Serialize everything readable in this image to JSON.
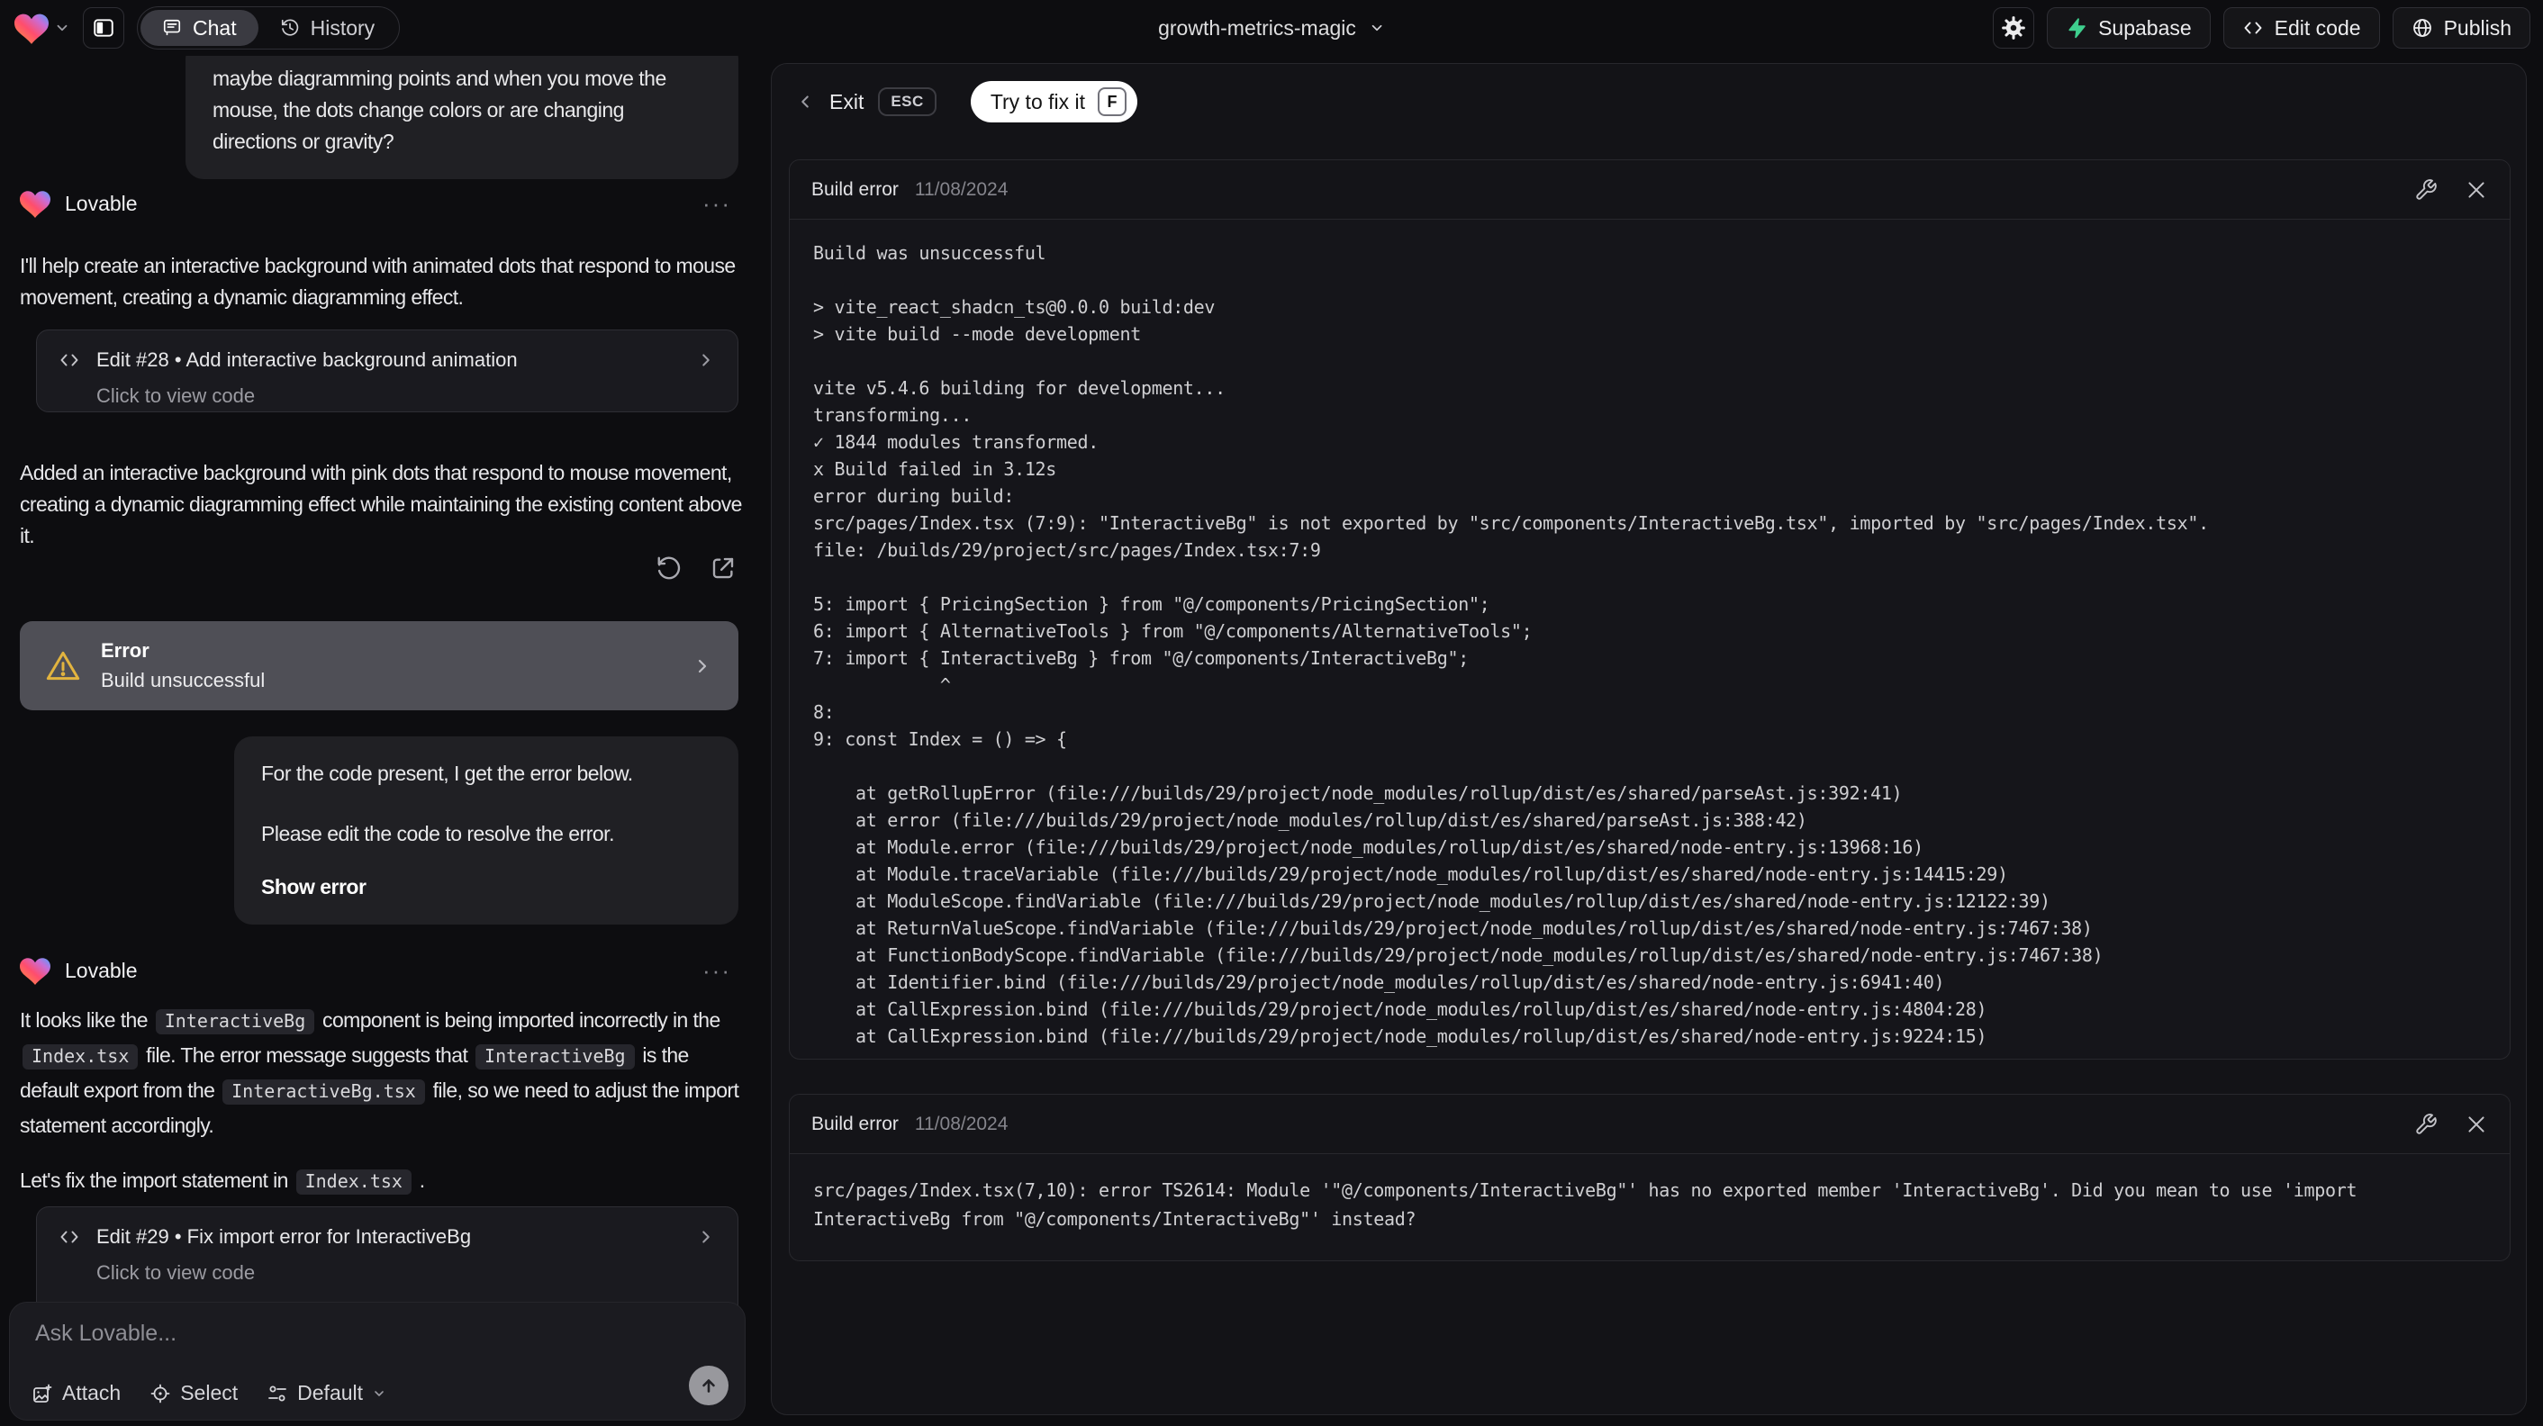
{
  "topbar": {
    "tabs": {
      "chat": "Chat",
      "history": "History"
    },
    "project_name": "growth-metrics-magic",
    "supabase_label": "Supabase",
    "edit_code_label": "Edit code",
    "publish_label": "Publish"
  },
  "chat": {
    "assistant_name": "Lovable",
    "menu_dots": "···",
    "user_message_top": "maybe diagramming points and when you move the mouse, the dots change colors or are changing directions or gravity?",
    "assistant_intro": "I'll help create an interactive background with animated dots that respond to mouse movement, creating a dynamic diagramming effect.",
    "edit_card_1": {
      "title": "Edit #28 • Add interactive background animation",
      "subtitle": "Click to view code"
    },
    "assistant_summary": "Added an interactive background with pink dots that respond to mouse movement, creating a dynamic diagramming effect while maintaining the existing content above it.",
    "error_card": {
      "title": "Error",
      "subtitle": "Build unsuccessful"
    },
    "user_error_message": {
      "line1": "For the code present, I get the error below.",
      "line2": "Please edit the code to resolve the error.",
      "action": "Show error"
    },
    "assistant_fix_rich": [
      {
        "text": "It looks like the "
      },
      {
        "code": "InteractiveBg"
      },
      {
        "text": " component is being imported incorrectly in the "
      },
      {
        "code": "Index.tsx"
      },
      {
        "text": " file. The error message suggests that "
      },
      {
        "code": "InteractiveBg"
      },
      {
        "text": " is the default export from the "
      },
      {
        "code": "InteractiveBg.tsx"
      },
      {
        "text": " file, so we need to adjust the import statement accordingly."
      }
    ],
    "assistant_fix_line": [
      {
        "text": "Let's fix the import statement in "
      },
      {
        "code": "Index.tsx"
      },
      {
        "text": " ."
      }
    ],
    "edit_card_2": {
      "title": "Edit #29 • Fix import error for InteractiveBg",
      "subtitle": "Click to view code"
    },
    "composer": {
      "placeholder": "Ask Lovable...",
      "attach_label": "Attach",
      "select_label": "Select",
      "mode_label": "Default"
    }
  },
  "preview": {
    "exit_label": "Exit",
    "esc_key": "ESC",
    "fix_button_label": "Try to fix it",
    "fix_key": "F",
    "panel1": {
      "title": "Build error",
      "date": "11/08/2024",
      "log_lines": [
        "Build was unsuccessful",
        "",
        "> vite_react_shadcn_ts@0.0.0 build:dev",
        "> vite build --mode development",
        "",
        "vite v5.4.6 building for development...",
        "transforming...",
        "✓ 1844 modules transformed.",
        "x Build failed in 3.12s",
        "error during build:",
        "src/pages/Index.tsx (7:9): \"InteractiveBg\" is not exported by \"src/components/InteractiveBg.tsx\", imported by \"src/pages/Index.tsx\".",
        "file: /builds/29/project/src/pages/Index.tsx:7:9",
        "",
        "5: import { PricingSection } from \"@/components/PricingSection\";",
        "6: import { AlternativeTools } from \"@/components/AlternativeTools\";",
        "7: import { InteractiveBg } from \"@/components/InteractiveBg\";",
        "            ^",
        "8: ",
        "9: const Index = () => {",
        "",
        "    at getRollupError (file:///builds/29/project/node_modules/rollup/dist/es/shared/parseAst.js:392:41)",
        "    at error (file:///builds/29/project/node_modules/rollup/dist/es/shared/parseAst.js:388:42)",
        "    at Module.error (file:///builds/29/project/node_modules/rollup/dist/es/shared/node-entry.js:13968:16)",
        "    at Module.traceVariable (file:///builds/29/project/node_modules/rollup/dist/es/shared/node-entry.js:14415:29)",
        "    at ModuleScope.findVariable (file:///builds/29/project/node_modules/rollup/dist/es/shared/node-entry.js:12122:39)",
        "    at ReturnValueScope.findVariable (file:///builds/29/project/node_modules/rollup/dist/es/shared/node-entry.js:7467:38)",
        "    at FunctionBodyScope.findVariable (file:///builds/29/project/node_modules/rollup/dist/es/shared/node-entry.js:7467:38)",
        "    at Identifier.bind (file:///builds/29/project/node_modules/rollup/dist/es/shared/node-entry.js:6941:40)",
        "    at CallExpression.bind (file:///builds/29/project/node_modules/rollup/dist/es/shared/node-entry.js:4804:28)",
        "    at CallExpression.bind (file:///builds/29/project/node_modules/rollup/dist/es/shared/node-entry.js:9224:15)"
      ]
    },
    "panel2": {
      "title": "Build error",
      "date": "11/08/2024",
      "log_lines": [
        "src/pages/Index.tsx(7,10): error TS2614: Module '\"@/components/InteractiveBg\"' has no exported member 'InteractiveBg'. Did you mean to use 'import InteractiveBg from \"@/components/InteractiveBg\"' instead?"
      ]
    }
  },
  "colors": {
    "warning_amber": "#e2b43f",
    "supabase_green": "#3ecf8e",
    "error_card_bg": "#4f4f56",
    "accent_bg_dark": "#0d0d10"
  }
}
